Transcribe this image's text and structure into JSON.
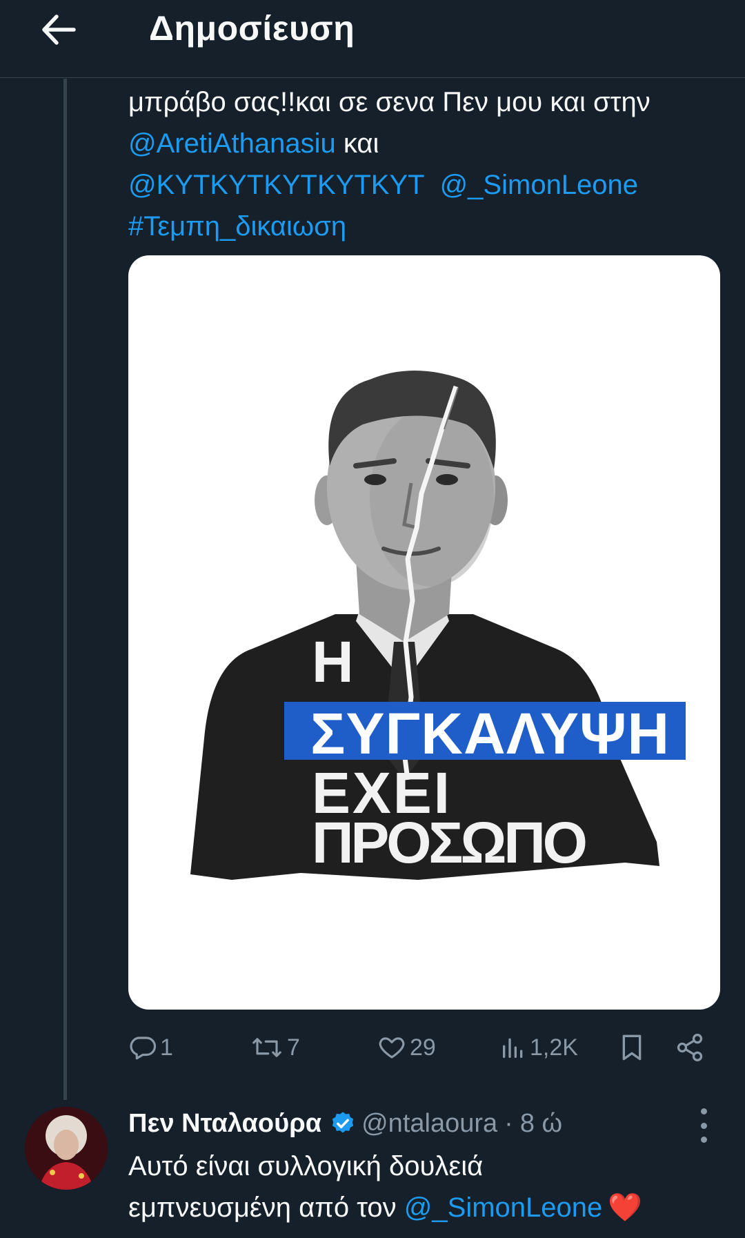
{
  "header": {
    "title": "Δημοσίευση",
    "back_icon": "arrow-left-icon"
  },
  "tweet": {
    "text_line1": "μπράβο σας!!και σε σενα Πεν μου και στην",
    "mention1": "@AretiAthanasiu",
    "text_and": " και",
    "mention2": "@ΚΥΤΚΥΤΚΥΤΚΥΤΚΥΤ",
    "mention3": "@_SimonLeone",
    "hashtag": "#Τεμπη_δικαιωση",
    "media": {
      "poster_line1": "Η",
      "poster_line2": "ΣΥΓΚΑΛΥΨΗ",
      "poster_line3": "ΕΧΕΙ",
      "poster_line4": "ΠΡΟΣΩΠΟ",
      "highlight_color": "#1f5ec9"
    },
    "actions": {
      "replies": "1",
      "retweets": "7",
      "likes": "29",
      "views": "1,2K"
    }
  },
  "reply": {
    "display_name": "Πεν Νταλαούρα",
    "handle": "@ntalaoura",
    "separator": "·",
    "time": "8 ώ",
    "text_line1": "Αυτό είναι συλλογική δουλειά",
    "text_line2_prefix": "εμπνευσμένη από τον ",
    "mention": "@_SimonLeone",
    "emoji": "❤️"
  },
  "colors": {
    "background": "#15202b",
    "link": "#1d9bf0",
    "muted": "#8b98a5",
    "divider": "#38444d"
  }
}
